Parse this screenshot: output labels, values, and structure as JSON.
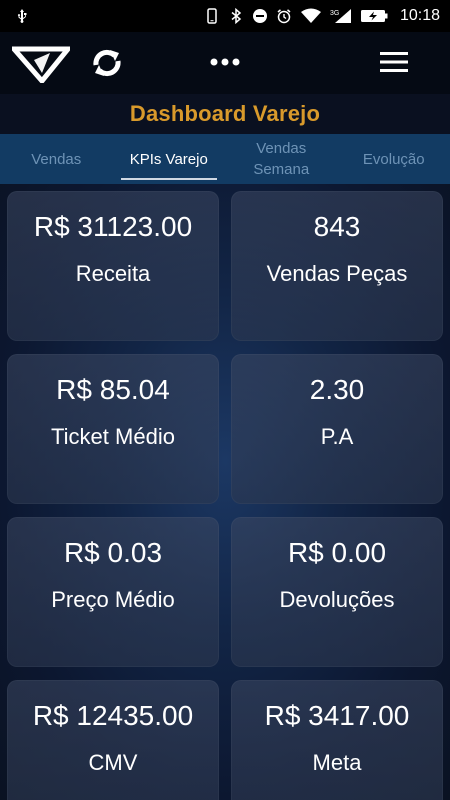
{
  "status_bar": {
    "time": "10:18",
    "network": "3G"
  },
  "header": {
    "title": "Dashboard Varejo"
  },
  "tabs": [
    {
      "label": "Vendas",
      "active": false
    },
    {
      "label": "KPIs Varejo",
      "active": true
    },
    {
      "label": "Vendas\nSemana",
      "active": false
    },
    {
      "label": "Evolução",
      "active": false
    }
  ],
  "kpis": [
    {
      "value": "R$ 31123.00",
      "label": "Receita"
    },
    {
      "value": "843",
      "label": "Vendas Peças"
    },
    {
      "value": "R$ 85.04",
      "label": "Ticket Médio"
    },
    {
      "value": "2.30",
      "label": "P.A"
    },
    {
      "value": "R$ 0.03",
      "label": "Preço Médio"
    },
    {
      "value": "R$ 0.00",
      "label": "Devoluções"
    },
    {
      "value": "R$ 12435.00",
      "label": "CMV"
    },
    {
      "value": "R$ 3417.00",
      "label": "Meta"
    }
  ],
  "colors": {
    "title": "#d99a2b",
    "tabs_bg": "#123b63",
    "tab_inactive": "#6e93b6"
  },
  "icons": [
    "usb-icon",
    "phone-icon",
    "bluetooth-icon",
    "dnd-icon",
    "alarm-icon",
    "wifi-icon",
    "signal-icon",
    "battery-charging-icon",
    "logo-icon",
    "refresh-icon",
    "more-dots-icon",
    "hamburger-menu-icon"
  ]
}
